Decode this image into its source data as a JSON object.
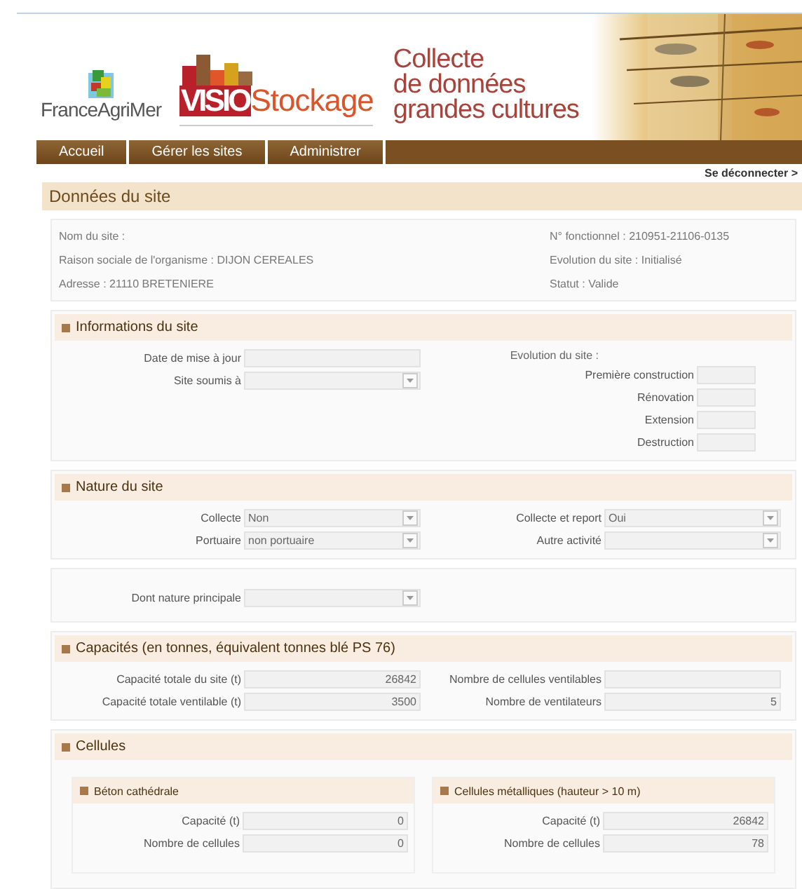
{
  "header": {
    "brand": "FranceAgriMer",
    "product_prefix": "VISIO",
    "product_name": "Stockage",
    "tagline_lines": [
      "Collecte",
      "de données",
      "grandes cultures"
    ]
  },
  "nav": {
    "tabs": [
      {
        "label": "Accueil",
        "selected": false
      },
      {
        "label": "Gérer les sites",
        "selected": false
      },
      {
        "label": "Administrer",
        "selected": false
      }
    ],
    "logout": "Se déconnecter >"
  },
  "page_title": "Données du site",
  "summary": {
    "left": [
      {
        "label": "Nom du site :"
      },
      {
        "label": "Raison sociale de l'organisme :",
        "value": "DIJON CEREALES"
      },
      {
        "label": "Adresse :",
        "value": "21110 BRETENIERE"
      }
    ],
    "right": [
      {
        "label": "N° fonctionnel :",
        "value": "210951-21106-0135"
      },
      {
        "label": "Evolution du site :",
        "value": "Initialisé"
      },
      {
        "label": "Statut :",
        "value": "Valide"
      }
    ]
  },
  "sections": [
    {
      "title": "Informations du site",
      "left": [
        {
          "kind": "text",
          "label": "Date de mise à jour"
        },
        {
          "kind": "select",
          "label": "Site soumis à"
        }
      ],
      "right_heading": "Evolution du site :",
      "right": [
        {
          "kind": "small",
          "label": "Première construction"
        },
        {
          "kind": "small",
          "label": "Rénovation"
        },
        {
          "kind": "small",
          "label": "Extension"
        },
        {
          "kind": "small",
          "label": "Destruction"
        }
      ]
    },
    {
      "title": "Nature du site",
      "left": [
        {
          "kind": "select",
          "label": "Collecte",
          "value": "Non"
        },
        {
          "kind": "select",
          "label": "Portuaire",
          "value": "non portuaire"
        }
      ],
      "right": [
        {
          "kind": "select",
          "label": "Collecte et report",
          "value": "Oui"
        },
        {
          "kind": "select",
          "label": "Autre activité"
        }
      ]
    },
    {
      "left": [
        {
          "kind": "select",
          "label": "Dont nature principale"
        }
      ]
    },
    {
      "title": "Capacités (en tonnes, équivalent tonnes blé PS 76)",
      "left": [
        {
          "kind": "number",
          "label": "Capacité totale du site (t)",
          "value": "26842"
        },
        {
          "kind": "number",
          "label": "Capacité totale ventilable (t)",
          "value": "3500"
        }
      ],
      "right": [
        {
          "kind": "number",
          "label": "Nombre de cellules ventilables"
        },
        {
          "kind": "number",
          "label": "Nombre de ventilateurs",
          "value": "5"
        }
      ]
    },
    {
      "title": "Cellules",
      "groups": [
        {
          "title": "Béton cathédrale",
          "fields": [
            {
              "kind": "number",
              "label": "Capacité (t)",
              "value": "0"
            },
            {
              "kind": "number",
              "label": "Nombre de cellules",
              "value": "0"
            }
          ]
        },
        {
          "title": "Cellules métalliques (hauteur > 10 m)",
          "fields": [
            {
              "kind": "number",
              "label": "Capacité (t)",
              "value": "26842"
            },
            {
              "kind": "number",
              "label": "Nombre de cellules",
              "value": "78"
            }
          ]
        }
      ]
    }
  ]
}
